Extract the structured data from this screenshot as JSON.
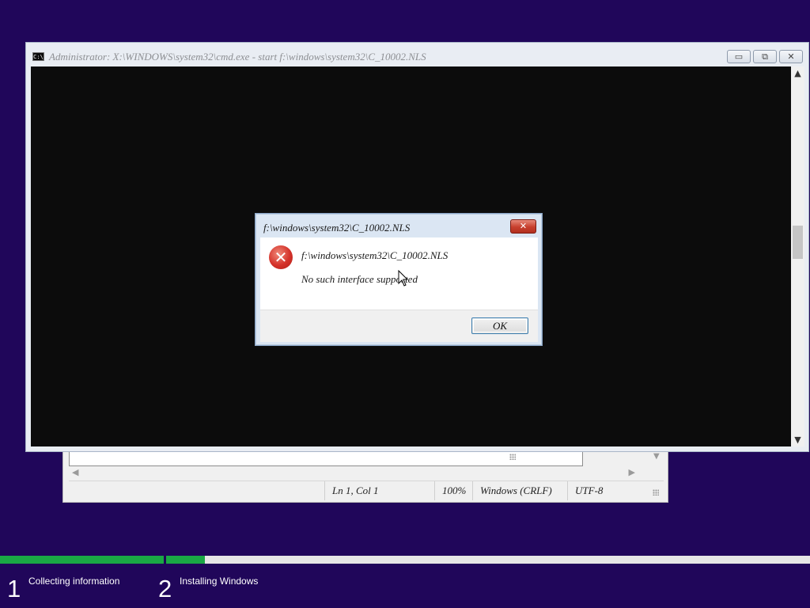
{
  "cmd_window": {
    "title": "Administrator: X:\\WINDOWS\\system32\\cmd.exe - start  f:\\windows\\system32\\C_10002.NLS",
    "icon_text": "C:\\",
    "buttons": {
      "minimize": "▭",
      "restore": "⧉",
      "close": "✕"
    }
  },
  "notepad": {
    "status": {
      "position": "Ln 1, Col 1",
      "zoom": "100%",
      "line_ending": "Windows (CRLF)",
      "encoding": "UTF-8"
    }
  },
  "dialog": {
    "title": "f:\\windows\\system32\\C_10002.NLS",
    "close_glyph": "✕",
    "icon_glyph": "✕",
    "message_path": "f:\\windows\\system32\\C_10002.NLS",
    "message_error": "No such interface supported",
    "ok_label": "OK"
  },
  "setup_progress": {
    "step1_fill": 1.0,
    "step2_fill": 0.06,
    "steps": [
      {
        "number": "1",
        "label": "Collecting information"
      },
      {
        "number": "2",
        "label": "Installing Windows"
      }
    ]
  },
  "colors": {
    "background": "#20065a",
    "progress": "#1aa845",
    "console": "#0c0c0c"
  }
}
